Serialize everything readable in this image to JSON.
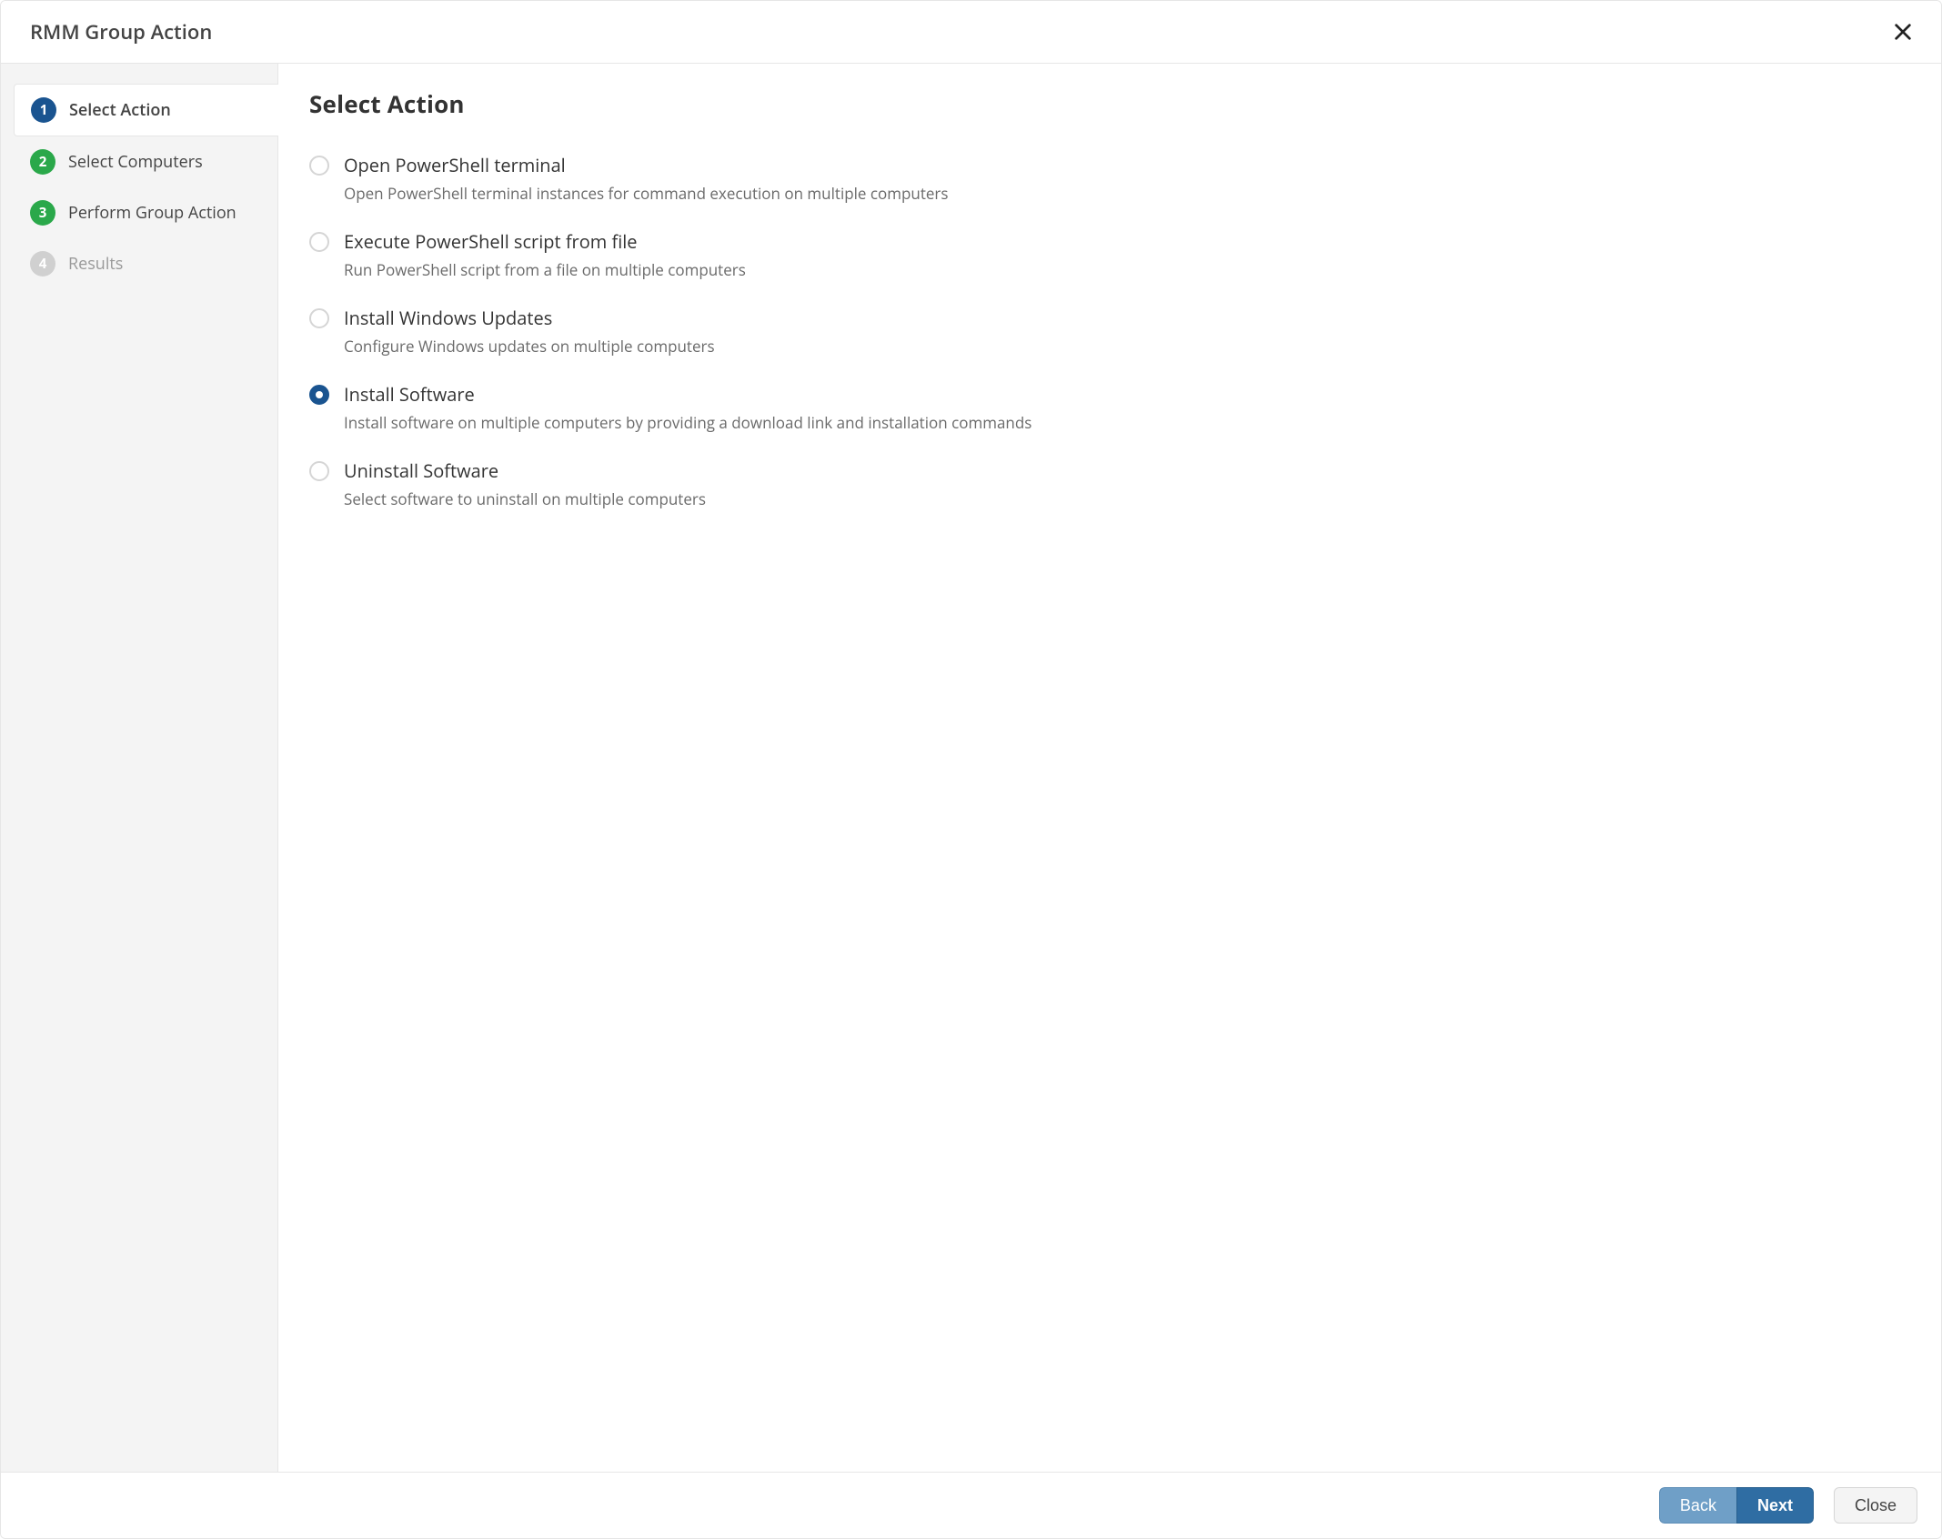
{
  "header": {
    "title": "RMM Group Action"
  },
  "steps": [
    {
      "num": "1",
      "label": "Select Action",
      "state": "active",
      "badge": "blue"
    },
    {
      "num": "2",
      "label": "Select Computers",
      "state": "done",
      "badge": "green"
    },
    {
      "num": "3",
      "label": "Perform Group Action",
      "state": "done",
      "badge": "green"
    },
    {
      "num": "4",
      "label": "Results",
      "state": "disabled",
      "badge": "gray"
    }
  ],
  "content": {
    "heading": "Select Action",
    "selected": "install-software",
    "options": [
      {
        "id": "open-powershell",
        "title": "Open PowerShell terminal",
        "desc": "Open PowerShell terminal instances for command execution on multiple computers"
      },
      {
        "id": "exec-ps-file",
        "title": "Execute PowerShell script from file",
        "desc": "Run PowerShell script from a file on multiple computers"
      },
      {
        "id": "install-updates",
        "title": "Install Windows Updates",
        "desc": "Configure Windows updates on multiple computers"
      },
      {
        "id": "install-software",
        "title": "Install Software",
        "desc": "Install software on multiple computers by providing a download link and installation commands"
      },
      {
        "id": "uninstall-software",
        "title": "Uninstall Software",
        "desc": "Select software to uninstall on multiple computers"
      }
    ]
  },
  "footer": {
    "back": "Back",
    "next": "Next",
    "close": "Close"
  }
}
